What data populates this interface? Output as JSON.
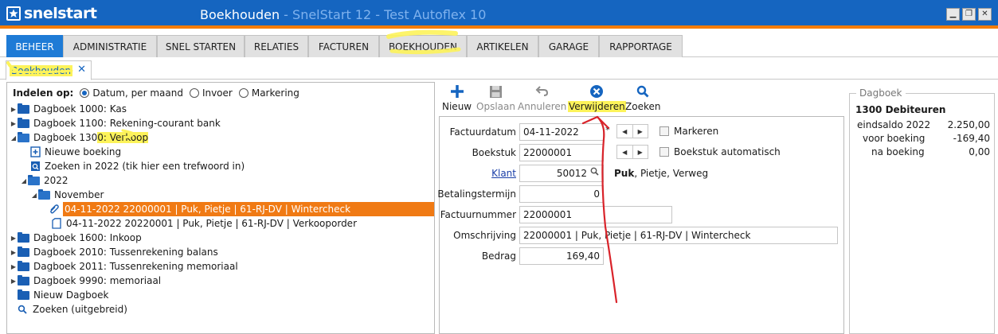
{
  "app": {
    "logo_text": "snelstart",
    "title": "Boekhouden",
    "title_sub": " - SnelStart 12 - Test Autoflex 10",
    "window_buttons": [
      "minimize-icon",
      "restore-icon",
      "close-icon"
    ]
  },
  "menu": {
    "tabs": [
      {
        "label": "BEHEER"
      },
      {
        "label": "ADMINISTRATIE"
      },
      {
        "label": "SNEL STARTEN"
      },
      {
        "label": "RELATIES"
      },
      {
        "label": "FACTUREN"
      },
      {
        "label": "BOEKHOUDEN"
      },
      {
        "label": "ARTIKELEN"
      },
      {
        "label": "GARAGE"
      },
      {
        "label": "RAPPORTAGE"
      }
    ],
    "active": "BEHEER"
  },
  "subtab": {
    "label": "Boekhouden",
    "close": "✕"
  },
  "grouping": {
    "label": "Indelen op:",
    "options": [
      "Datum, per maand",
      "Invoer",
      "Markering"
    ],
    "selected": "Datum, per maand"
  },
  "tree": {
    "kas": "Dagboek 1000: Kas",
    "bank": "Dagboek 1100: Rekening-courant bank",
    "verkoop_a": "Dagboek 130",
    "verkoop_b": "0: Verkoop",
    "nieuwe_boeking": "Nieuwe boeking",
    "zoeken_2022": "Zoeken in 2022 (tik hier een trefwoord in)",
    "year": "2022",
    "month": "November",
    "entry1": "04-11-2022 22000001 | Puk, Pietje | 61-RJ-DV | Wintercheck",
    "entry2": "04-11-2022 20220001 | Puk, Pietje | 61-RJ-DV | Verkooporder",
    "inkoop": "Dagboek 1600: Inkoop",
    "tussen_balans": "Dagboek 2010: Tussenrekening balans",
    "tussen_memoriaal": "Dagboek 2011: Tussenrekening memoriaal",
    "memoriaal": "Dagboek 9990: memoriaal",
    "nieuw_dagboek": "Nieuw Dagboek",
    "zoeken_uitgebreid": "Zoeken (uitgebreid)"
  },
  "toolbar": {
    "nieuw": "Nieuw",
    "opslaan": "Opslaan",
    "annuleren": "Annuleren",
    "verwijderen": "Verwijderen",
    "zoeken": "Zoeken"
  },
  "form": {
    "factuurdatum": {
      "label": "Factuurdatum",
      "value": "04-11-2022",
      "asterisk": "*"
    },
    "boekstuk": {
      "label": "Boekstuk",
      "value": "22000001"
    },
    "klant": {
      "label": "Klant",
      "value": "50012",
      "name_bold": "Puk",
      "name_rest": ", Pietje, Verweg"
    },
    "betalingstermijn": {
      "label": "Betalingstermijn",
      "value": "0"
    },
    "factuurnummer": {
      "label": "Factuurnummer",
      "value": "22000001"
    },
    "omschrijving": {
      "label": "Omschrijving",
      "value": "22000001 | Puk, Pietje | 61-RJ-DV | Wintercheck"
    },
    "bedrag": {
      "label": "Bedrag",
      "value": "169,40"
    },
    "markeren": "Markeren",
    "boekstuk_auto": "Boekstuk automatisch"
  },
  "dagboek_panel": {
    "title": "Dagboek",
    "account": "1300 Debiteuren",
    "rows": [
      {
        "label": "eindsaldo 2022",
        "value": "2.250,00"
      },
      {
        "label": "voor boeking",
        "value": "-169,40"
      },
      {
        "label": "na boeking",
        "value": "0,00"
      }
    ]
  },
  "colors": {
    "titlebar": "#1565c0",
    "accent_orange": "#f07a14",
    "active_tab": "#1e7bd6",
    "highlighter": "#fdf35a",
    "annotation_red": "#d9232a"
  }
}
